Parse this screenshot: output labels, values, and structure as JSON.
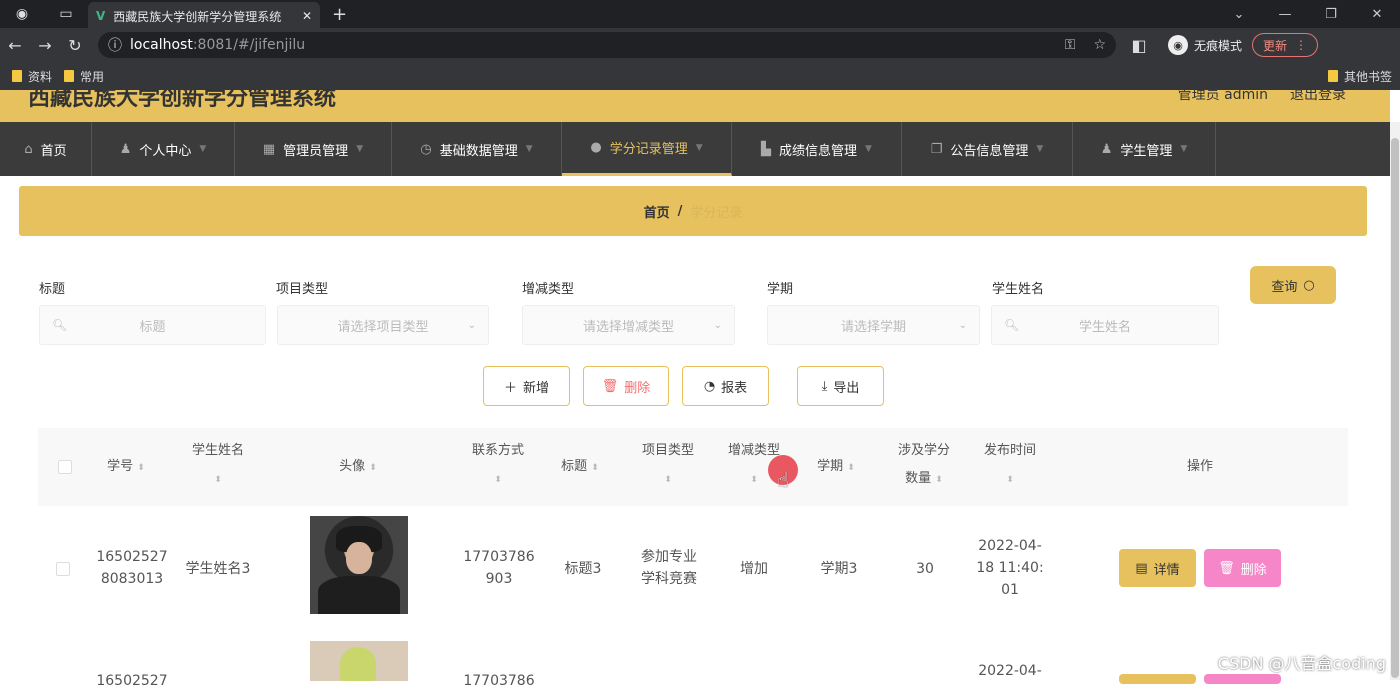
{
  "browser": {
    "tab_title": "西藏民族大学创新学分管理系统",
    "url_host": "localhost",
    "url_port_path": ":8081/#/jifenjilu",
    "profile_label": "无痕模式",
    "update_label": "更新",
    "bookmarks": [
      "资料",
      "常用"
    ],
    "other_bookmarks": "其他书签"
  },
  "site": {
    "title": "西藏民族大学创新学分管理系统",
    "user_label": "管理员 admin",
    "logout_label": "退出登录"
  },
  "menu": [
    {
      "label": "首页",
      "icon": "home-icon"
    },
    {
      "label": "个人中心",
      "icon": "user-icon"
    },
    {
      "label": "管理员管理",
      "icon": "grid-icon"
    },
    {
      "label": "基础数据管理",
      "icon": "clock-icon"
    },
    {
      "label": "学分记录管理",
      "icon": "location-icon",
      "active": true
    },
    {
      "label": "成绩信息管理",
      "icon": "camera-icon"
    },
    {
      "label": "公告信息管理",
      "icon": "copy-icon"
    },
    {
      "label": "学生管理",
      "icon": "user-icon"
    }
  ],
  "breadcrumb": {
    "home": "首页",
    "sep": "/",
    "current": "学分记录"
  },
  "filters": {
    "title_label": "标题",
    "title_placeholder": "标题",
    "proj_label": "项目类型",
    "proj_placeholder": "请选择项目类型",
    "inc_label": "增减类型",
    "inc_placeholder": "请选择增减类型",
    "term_label": "学期",
    "term_placeholder": "请选择学期",
    "name_label": "学生姓名",
    "name_placeholder": "学生姓名",
    "query_label": "查询"
  },
  "actions": {
    "add": "新增",
    "delete": "删除",
    "report": "报表",
    "export": "导出"
  },
  "table": {
    "headers": {
      "xuehao": "学号",
      "name": "学生姓名",
      "avatar": "头像",
      "phone": "联系方式",
      "title": "标题",
      "proj": "项目类型",
      "inc": "增减类型",
      "term": "学期",
      "credit1": "涉及学分",
      "credit2": "数量",
      "time": "发布时间",
      "op": "操作"
    },
    "rows": [
      {
        "xuehao_1": "16502527",
        "xuehao_2": "8083013",
        "name": "学生姓名3",
        "phone_1": "17703786",
        "phone_2": "903",
        "title": "标题3",
        "proj_1": "参加专业",
        "proj_2": "学科竞赛",
        "inc": "增加",
        "term": "学期3",
        "credit": "30",
        "time_1": "2022-04-",
        "time_2": "18 11:40:",
        "time_3": "01"
      },
      {
        "xuehao_1": "16502527",
        "phone_1": "17703786",
        "time_1": "2022-04-"
      }
    ],
    "detail_label": "详情",
    "delete_label": "删除"
  },
  "watermark": "CSDN @八音盒coding"
}
